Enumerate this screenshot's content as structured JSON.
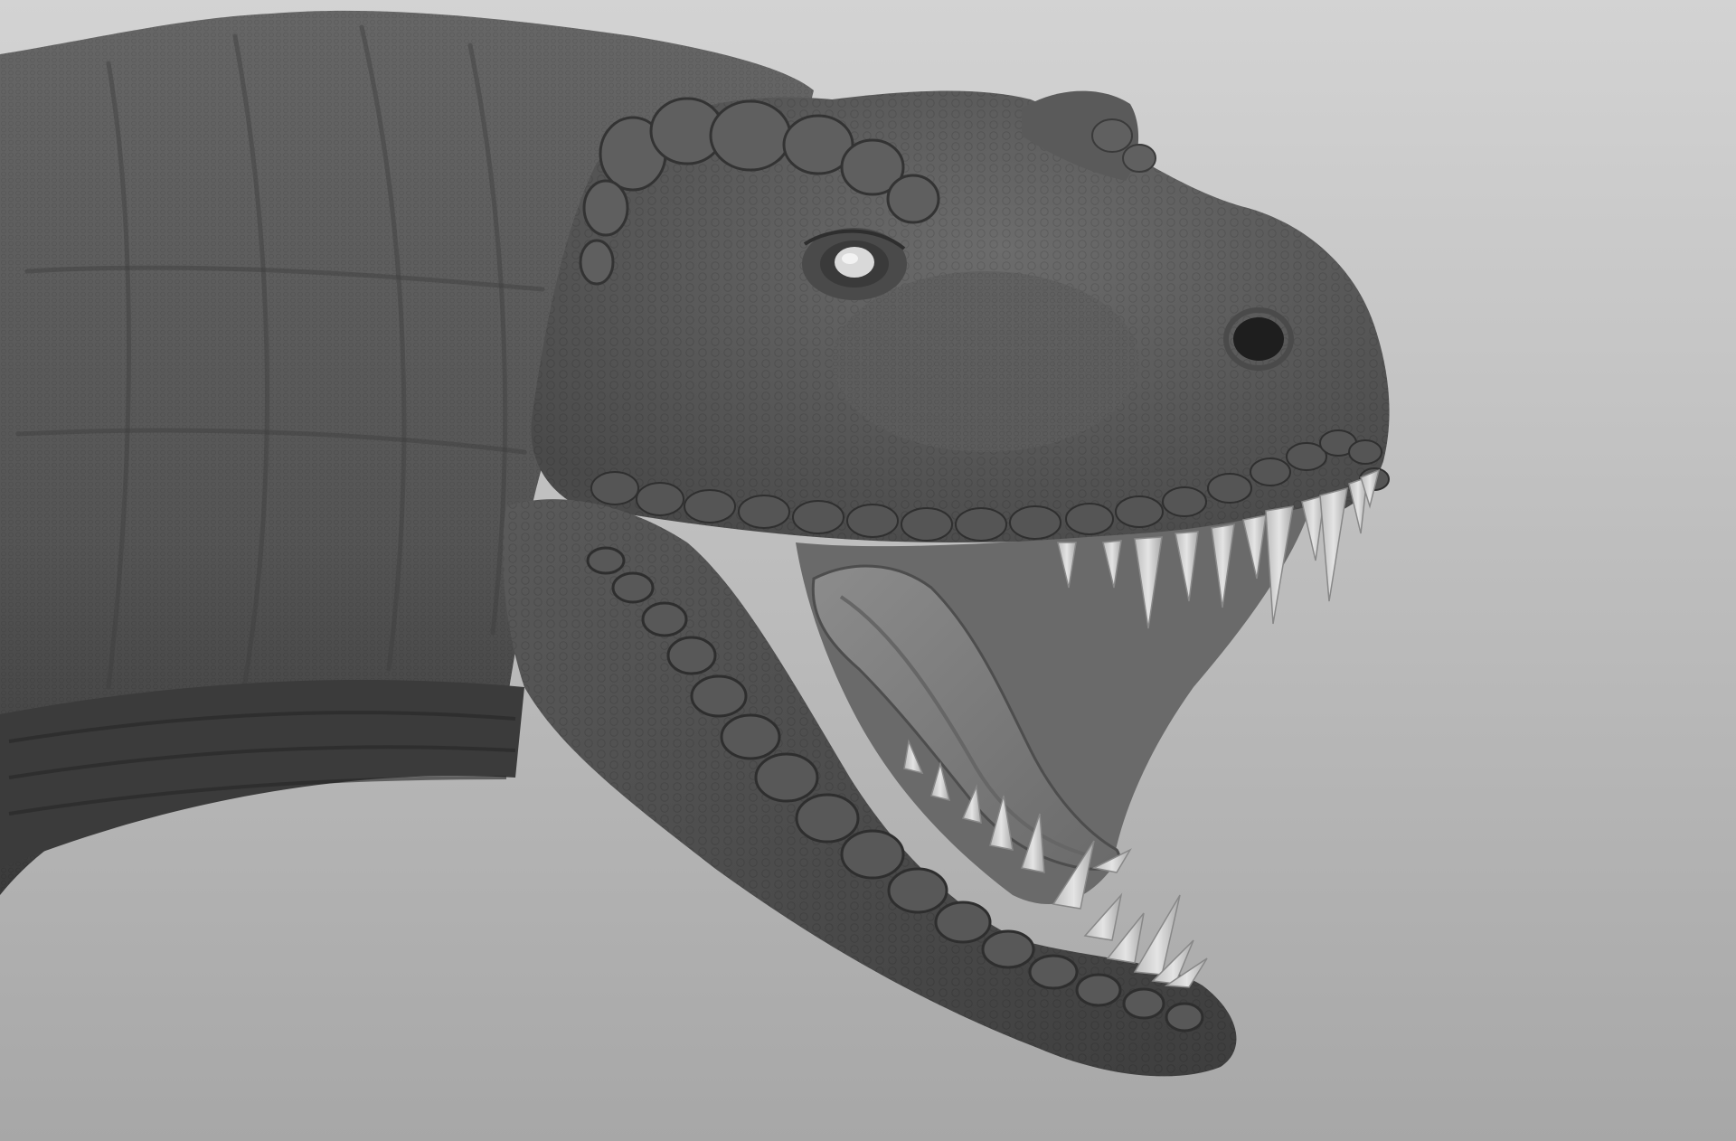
{
  "scene": {
    "subject": "sculpted-tyrannosaurus-head",
    "background_top_color": "#d3d3d3",
    "background_bottom_color": "#a7a7a7",
    "skin_color": "#5b5b5b",
    "skin_dark_color": "#3c3c3c",
    "skin_light_color": "#7a7a7a",
    "mouth_color": "#6e6e6e",
    "tongue_color": "#858585",
    "tooth_color": "#d2d2d2",
    "eye_color": "#d9d9d9"
  }
}
